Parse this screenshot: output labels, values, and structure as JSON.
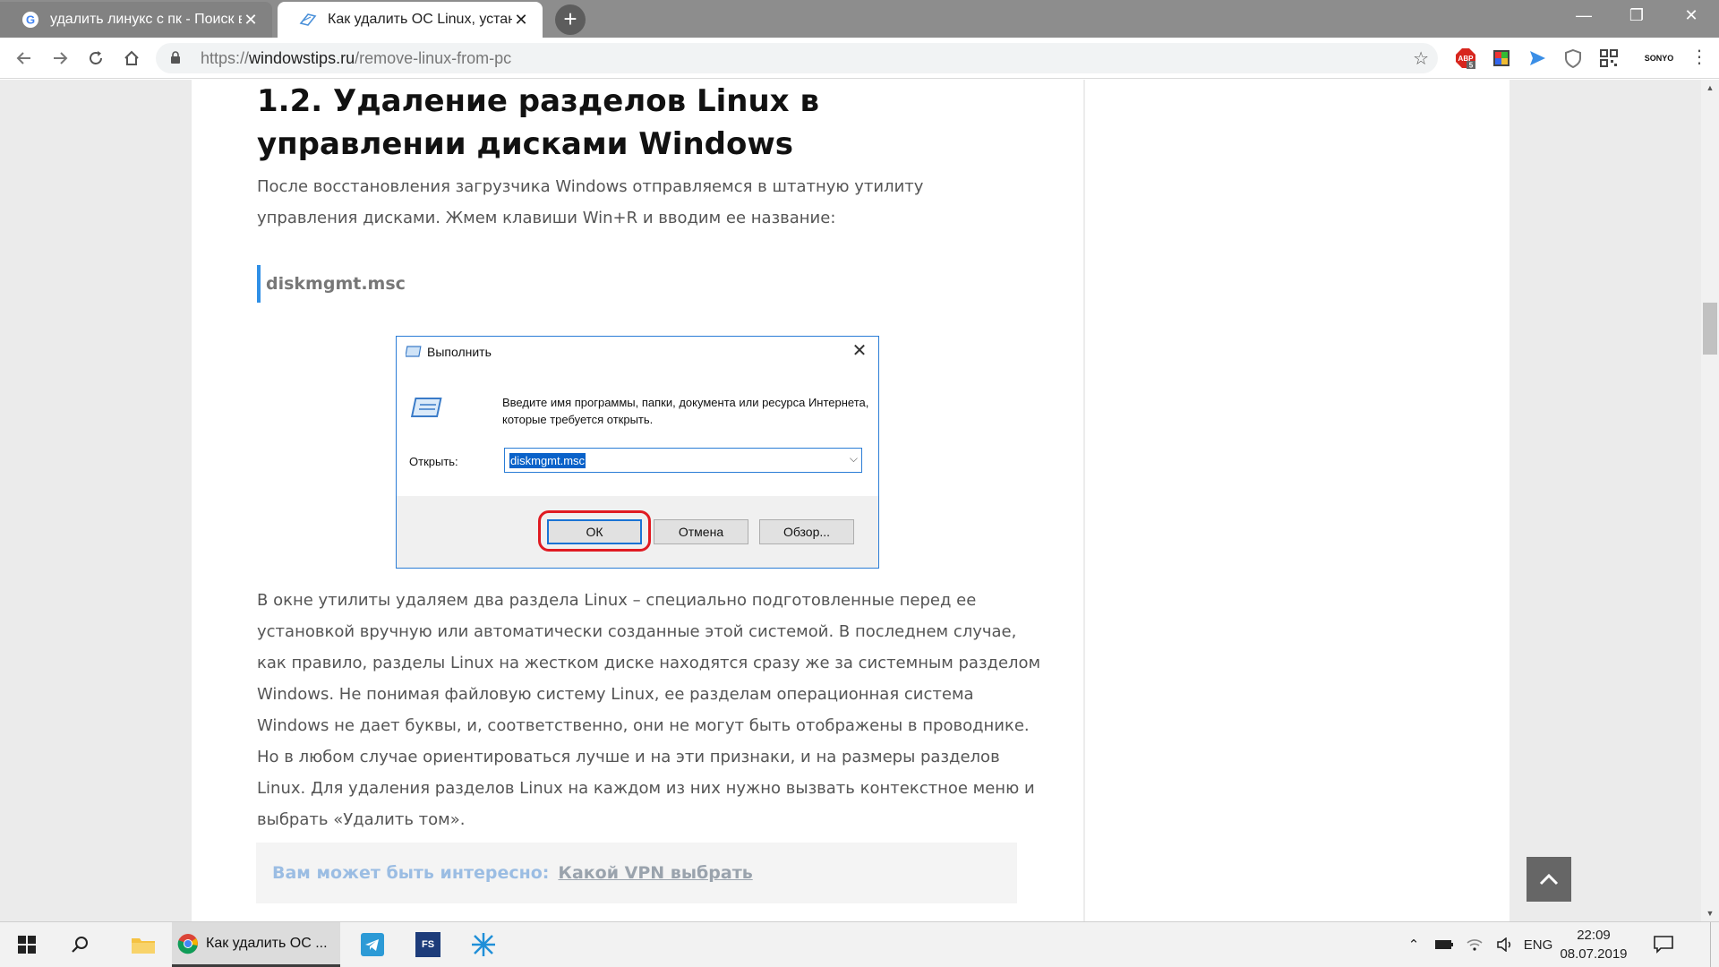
{
  "browser": {
    "tabs": [
      {
        "title": "удалить линукс с пк - Поиск в Google",
        "favicon": "google-g-icon",
        "active": false
      },
      {
        "title": "Как удалить ОС Linux, установленную",
        "favicon": "windowstips-favicon",
        "active": true
      }
    ],
    "new_tab_label": "+",
    "window_controls": {
      "minimize": "—",
      "maximize": "❐",
      "close": "✕"
    },
    "address": {
      "scheme": "https://",
      "host": "windowstips.ru",
      "path": "/remove-linux-from-pc"
    },
    "extensions": [
      "adblock-icon",
      "color-picker-icon",
      "send-icon",
      "shield-icon",
      "qr-icon",
      "sonyo-icon"
    ],
    "ext_badge": "5",
    "ext_label_sonyo": "SONYO"
  },
  "article": {
    "heading": "1.2. Удаление разделов Linux в управлении дисками Windows",
    "para1": "После восстановления загрузчика Windows отправляемся в штатную утилиту управления дисками. Жмем клавиши Win+R и вводим ее название:",
    "code": "diskmgmt.msc",
    "para2": "В окне утилиты удаляем два раздела Linux – специально подготовленные перед ее установкой вручную или автоматически созданные этой системой. В последнем случае, как правило, разделы Linux на жестком диске находятся сразу же за системным разделом Windows. Не понимая файловую систему Linux, ее разделам операционная система Windows не дает буквы, и, соответственно, они не могут быть отображены в проводнике. Но в любом случае ориентироваться лучше и на эти признаки, и на размеры разделов Linux. Для удаления разделов Linux на каждом из них нужно вызвать контекстное меню и выбрать «Удалить том».",
    "interest_label": "Вам может быть интересно:",
    "interest_link": "Какой VPN выбрать"
  },
  "run_dialog": {
    "title": "Выполнить",
    "description": "Введите имя программы, папки, документа или ресурса Интернета, которые требуется открыть.",
    "open_label": "Открыть:",
    "input_value": "diskmgmt.msc",
    "ok": "ОК",
    "cancel": "Отмена",
    "browse": "Обзор..."
  },
  "taskbar": {
    "chrome_label": "Как удалить ОС ...",
    "fs_label": "FS",
    "lang": "ENG",
    "time": "22:09",
    "date": "08.07.2019"
  },
  "colors": {
    "code_accent": "#2f8fe6",
    "ok_highlight": "#e01b22",
    "dialog_border": "#2b7dd6",
    "selection": "#0a62c9"
  }
}
